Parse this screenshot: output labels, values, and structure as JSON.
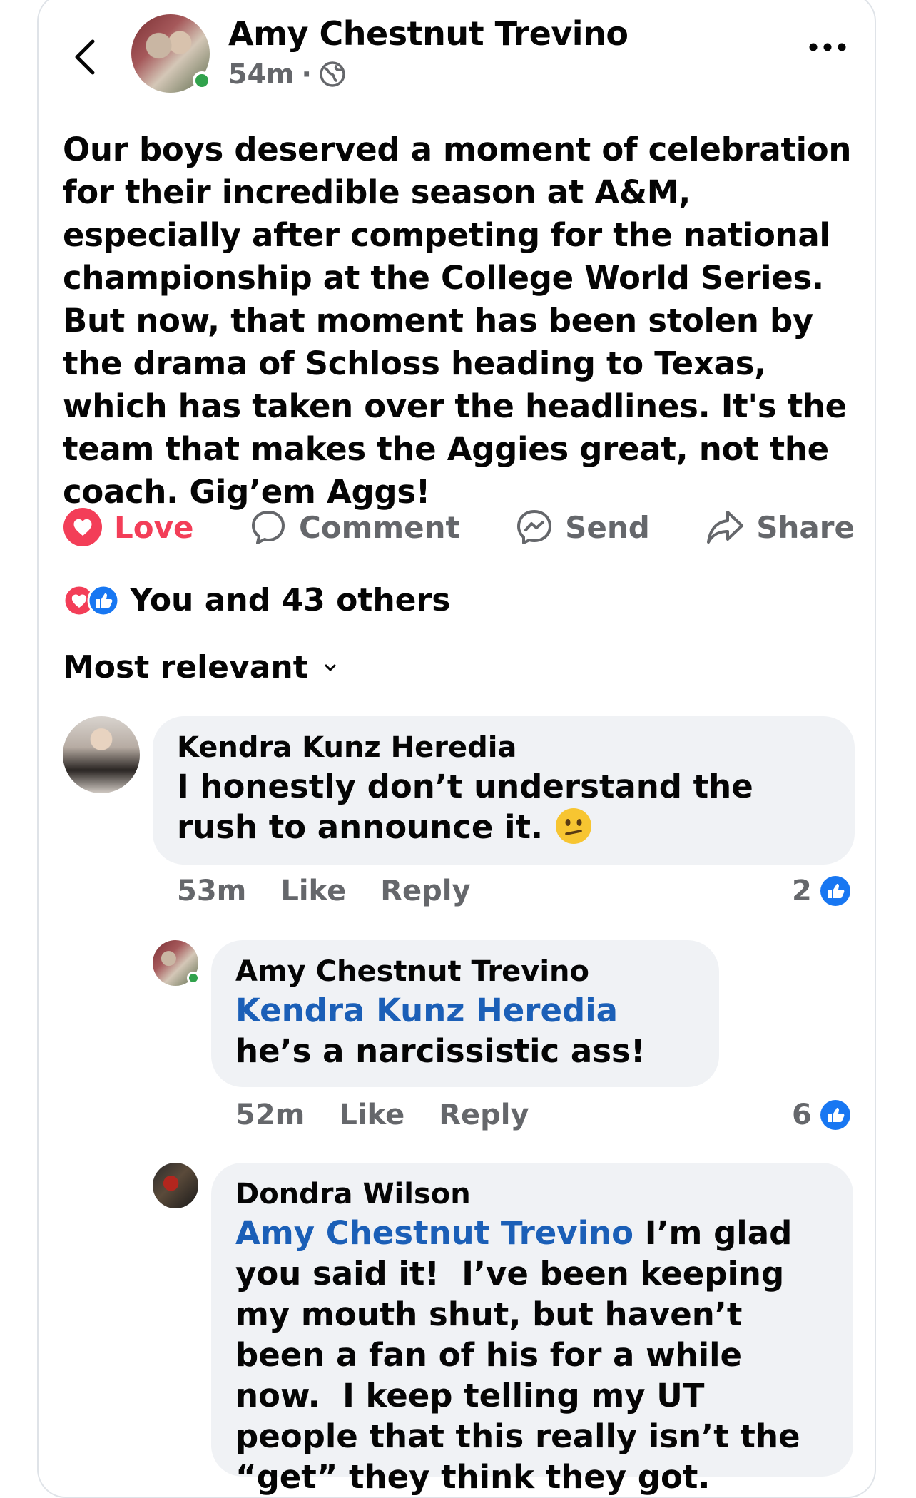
{
  "post": {
    "author": "Amy Chestnut Trevino",
    "time": "54m",
    "separator": "·",
    "privacy_icon": "globe-icon",
    "text": "Our boys deserved a moment of celebration for their incredible season at A&M, especially after competing for the national championship at the College World Series. But now, that moment has been stolen by the drama of Schloss heading to Texas, which has taken over the headlines. It's the team that makes the Aggies great, not the coach. Gig’em Aggs!"
  },
  "actions": {
    "love": "Love",
    "comment": "Comment",
    "send": "Send",
    "share": "Share"
  },
  "reactions": {
    "summary": "You and 43 others"
  },
  "sort": {
    "label": "Most relevant"
  },
  "comments": [
    {
      "author": "Kendra Kunz Heredia",
      "text": "I honestly don’t understand the rush to announce it.",
      "emoji": "confused-face-emoji",
      "time": "53m",
      "like": "Like",
      "reply": "Reply",
      "likes": "2"
    },
    {
      "author": "Amy Chestnut Trevino",
      "mention": "Kendra Kunz Heredia",
      "text": "he’s a narcissistic ass!",
      "time": "52m",
      "like": "Like",
      "reply": "Reply",
      "likes": "6"
    },
    {
      "author": "Dondra Wilson",
      "mention": "Amy Chestnut Trevino",
      "text": "I’m glad you said it!  I’ve been keeping my mouth shut, but haven’t been a fan of his for a while now.  I keep telling my UT people that this really isn’t the “get” they think they got."
    }
  ],
  "colors": {
    "love": "#f33e58",
    "like_blue": "#1877f2",
    "mention": "#1b5fb7",
    "muted": "#65676b",
    "bubble": "#f0f2f5",
    "online": "#31a24c"
  }
}
